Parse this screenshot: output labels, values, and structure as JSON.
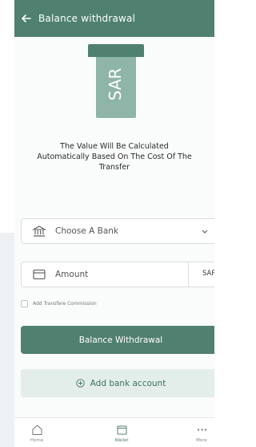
{
  "header": {
    "title": "Balance withdrawal",
    "back_icon": "arrow-left-icon"
  },
  "illustration": {
    "currency_label": "SAR"
  },
  "message": {
    "line1": "The Value Will Be Calculated",
    "line2": "Automatically Based On The Cost Of The",
    "line3": "Transfer"
  },
  "bank_field": {
    "label": "Choose A Bank",
    "icon": "bank-icon"
  },
  "amount_field": {
    "label": "Amount",
    "currency": "SAR",
    "icon": "card-icon"
  },
  "commission": {
    "label": "Add Transfere Commission",
    "checked": false
  },
  "buttons": {
    "withdraw_label": "Balance Withdrawal",
    "add_bank_label": "Add bank account"
  },
  "bottom_nav": {
    "items": [
      {
        "label": "Home",
        "icon": "home-icon"
      },
      {
        "label": "Wallet",
        "icon": "wallet-icon",
        "active": true
      },
      {
        "label": "More",
        "icon": "more-icon"
      }
    ]
  },
  "colors": {
    "primary": "#4f8070",
    "secondary_bg": "#e3eeeb"
  }
}
